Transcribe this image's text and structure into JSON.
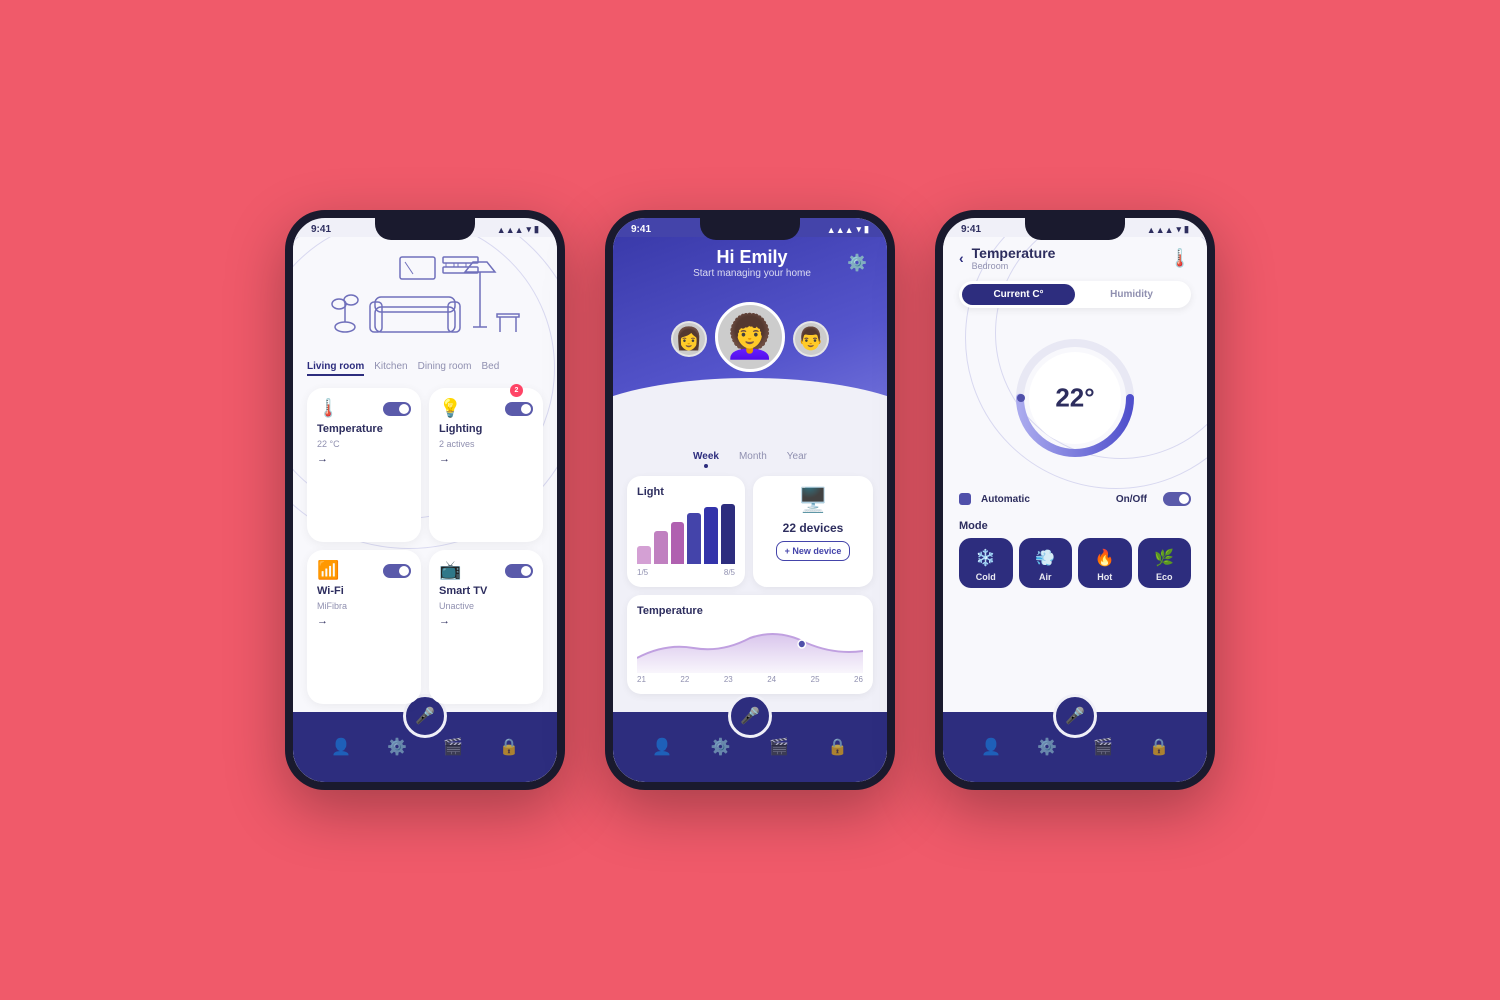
{
  "background": "#f05a6a",
  "phone1": {
    "status_time": "9:41",
    "rooms": [
      "Living room",
      "Kitchen",
      "Dining room",
      "Bed"
    ],
    "active_room": "Living room",
    "devices": [
      {
        "icon": "🌡️",
        "name": "Temperature",
        "sub": "22 °C",
        "toggle": "on",
        "badge": null
      },
      {
        "icon": "💡",
        "name": "Lighting",
        "sub": "2 actives",
        "toggle": "on",
        "badge": "2"
      },
      {
        "icon": "📶",
        "name": "Wi-Fi",
        "sub": "MiFibra",
        "toggle": "on",
        "badge": null
      },
      {
        "icon": "📺",
        "name": "Smart TV",
        "sub": "Unactive",
        "toggle": "on",
        "badge": null
      }
    ],
    "nav_icons": [
      "👤",
      "⚙️",
      "🎤",
      "🎬",
      "🔒"
    ]
  },
  "phone2": {
    "status_time": "9:41",
    "greeting": "Hi Emily",
    "subtitle": "Start managing your home",
    "period_tabs": [
      "Week",
      "Month",
      "Year"
    ],
    "active_period": "Week",
    "light_card": {
      "label": "Light",
      "dates": [
        "1/5",
        "8/5"
      ]
    },
    "devices_card": {
      "count": "22 devices",
      "new_label": "+ New device"
    },
    "temp_card": {
      "label": "Temperature",
      "dates": [
        "21",
        "22",
        "23",
        "24",
        "25",
        "26"
      ]
    }
  },
  "phone3": {
    "status_time": "9:41",
    "page_title": "Temperature",
    "page_sub": "Bedroom",
    "tabs": [
      "Current C°",
      "Humidity"
    ],
    "active_tab": "Current C°",
    "temp_value": "22°",
    "auto_label": "Automatic",
    "onoff_label": "On/Off",
    "mode_title": "Mode",
    "modes": [
      {
        "icon": "❄️",
        "label": "Cold"
      },
      {
        "icon": "💨",
        "label": "Air"
      },
      {
        "icon": "🔥",
        "label": "Hot"
      },
      {
        "icon": "🌿",
        "label": "Eco"
      }
    ]
  }
}
